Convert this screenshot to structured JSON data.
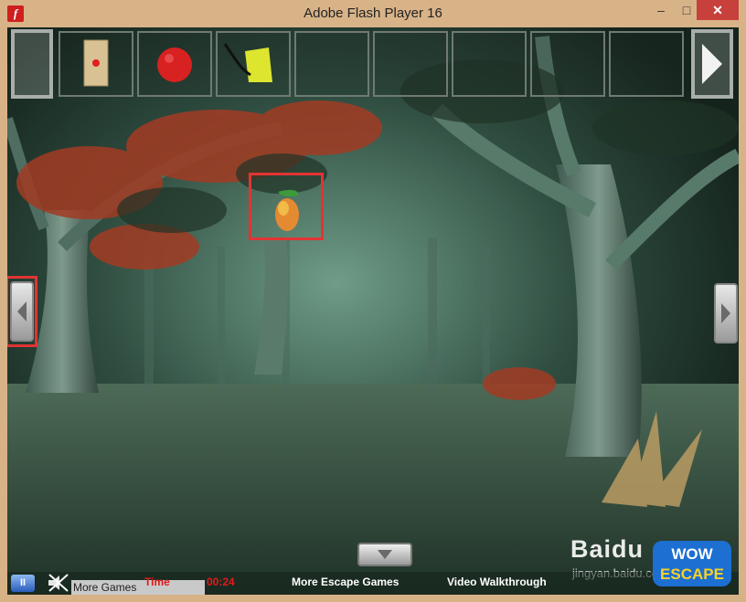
{
  "window": {
    "title": "Adobe Flash Player 16",
    "app_icon_glyph": "f",
    "min_glyph": "–",
    "max_glyph": "□",
    "close_glyph": "✕"
  },
  "colors": {
    "highlight": "#e33333",
    "time_text": "#e01b1b",
    "titlebar": "#d9b388"
  },
  "inventory": {
    "slots": [
      "door-panel-red-dot",
      "red-ball",
      "yellow-object",
      "empty",
      "empty",
      "empty",
      "empty",
      "empty"
    ]
  },
  "bottom_bar": {
    "pause_glyph": "II",
    "more_games": "More Games",
    "time_label": "Time",
    "time_value": "00:24",
    "escape_games_link": "More Escape Games",
    "walkthrough_link": "Video Walkthrough"
  },
  "watermark": {
    "logo": "Baidu",
    "url": "jingyan.baidu.com"
  },
  "brand_logo": {
    "line1": "WOW",
    "line2": "ESCAPE"
  }
}
